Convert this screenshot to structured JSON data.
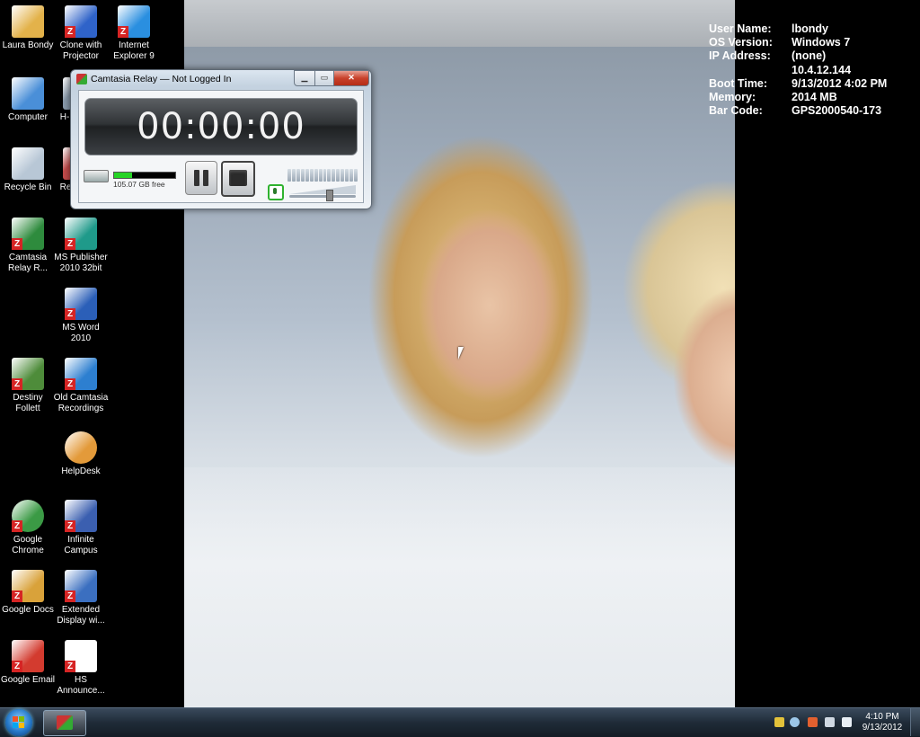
{
  "desktop": {
    "icons": [
      {
        "label": "Laura Bondy",
        "icon": "folder-icon",
        "color": "#e3b24a"
      },
      {
        "label": "Clone with Projector",
        "icon": "display-clone-icon",
        "color": "#2f63c9"
      },
      {
        "label": "Internet Explorer 9",
        "icon": "internet-explorer-icon",
        "color": "#2a8fe0"
      },
      {
        "label": "Computer",
        "icon": "computer-icon",
        "color": "#4a8fd8"
      },
      {
        "label": "H-",
        "icon": "network-drive-icon",
        "color": "#8899aa"
      },
      {
        "label": "Recycle Bin",
        "icon": "recycle-bin-icon",
        "color": "#b8c7d6"
      },
      {
        "label": "Re",
        "icon": "shortcut-icon",
        "color": "#c24a4a"
      },
      {
        "label": "Camtasia Relay R...",
        "icon": "camtasia-relay-icon",
        "color": "#2e8b3d"
      },
      {
        "label": "MS Publisher 2010 32bit",
        "icon": "ms-publisher-icon",
        "color": "#1f9a8a"
      },
      {
        "label": "MS Word 2010",
        "icon": "ms-word-icon",
        "color": "#2b5fb8"
      },
      {
        "label": "Destiny Follett",
        "icon": "destiny-tree-icon",
        "color": "#4e8c3a"
      },
      {
        "label": "Old Camtasia Recordings",
        "icon": "globe-folder-icon",
        "color": "#2d7fd0"
      },
      {
        "label": "HelpDesk",
        "icon": "lifebuoy-icon",
        "color": "#e39a3a"
      },
      {
        "label": "Google Chrome",
        "icon": "chrome-icon",
        "color": "#3b9a45"
      },
      {
        "label": "Infinite Campus",
        "icon": "infinite-campus-icon",
        "color": "#3b5fb0"
      },
      {
        "label": "Google Docs",
        "icon": "google-docs-icon",
        "color": "#d9a23a"
      },
      {
        "label": "Extended Display wi...",
        "icon": "extended-display-icon",
        "color": "#3b6fc0"
      },
      {
        "label": "Google Email",
        "icon": "gmail-icon",
        "color": "#d33b2f"
      },
      {
        "label": "HS Announce...",
        "icon": "hs-announce-icon",
        "color": "#222222"
      }
    ]
  },
  "info_panel": {
    "rows": [
      {
        "key": "User Name:",
        "value": "lbondy"
      },
      {
        "key": "OS Version:",
        "value": "Windows 7"
      },
      {
        "key": "IP Address:",
        "value": "(none)"
      },
      {
        "key": "",
        "value": "10.4.12.144"
      },
      {
        "key": "Boot Time:",
        "value": "9/13/2012 4:02 PM"
      },
      {
        "key": "Memory:",
        "value": "2014 MB"
      },
      {
        "key": "Bar Code:",
        "value": "GPS2000540-173"
      }
    ]
  },
  "relay_window": {
    "title": "Camtasia Relay — Not Logged In",
    "minimize": "▁",
    "maximize": "▭",
    "close": "✕",
    "timer": "00:00:00",
    "disk_free": "105.07 GB free",
    "disk_fill": 0.3,
    "volume_level": 0.6,
    "meter_segments": 16
  },
  "taskbar": {
    "clock_time": "4:10 PM",
    "clock_date": "9/13/2012",
    "tray_icons": [
      "action-center-icon",
      "network-globe-icon",
      "flag-icon",
      "network-icon",
      "volume-icon"
    ]
  },
  "colors": {
    "accent": "#2679c9",
    "meter_fill": "#26d426",
    "close_red": "#c8412b"
  }
}
